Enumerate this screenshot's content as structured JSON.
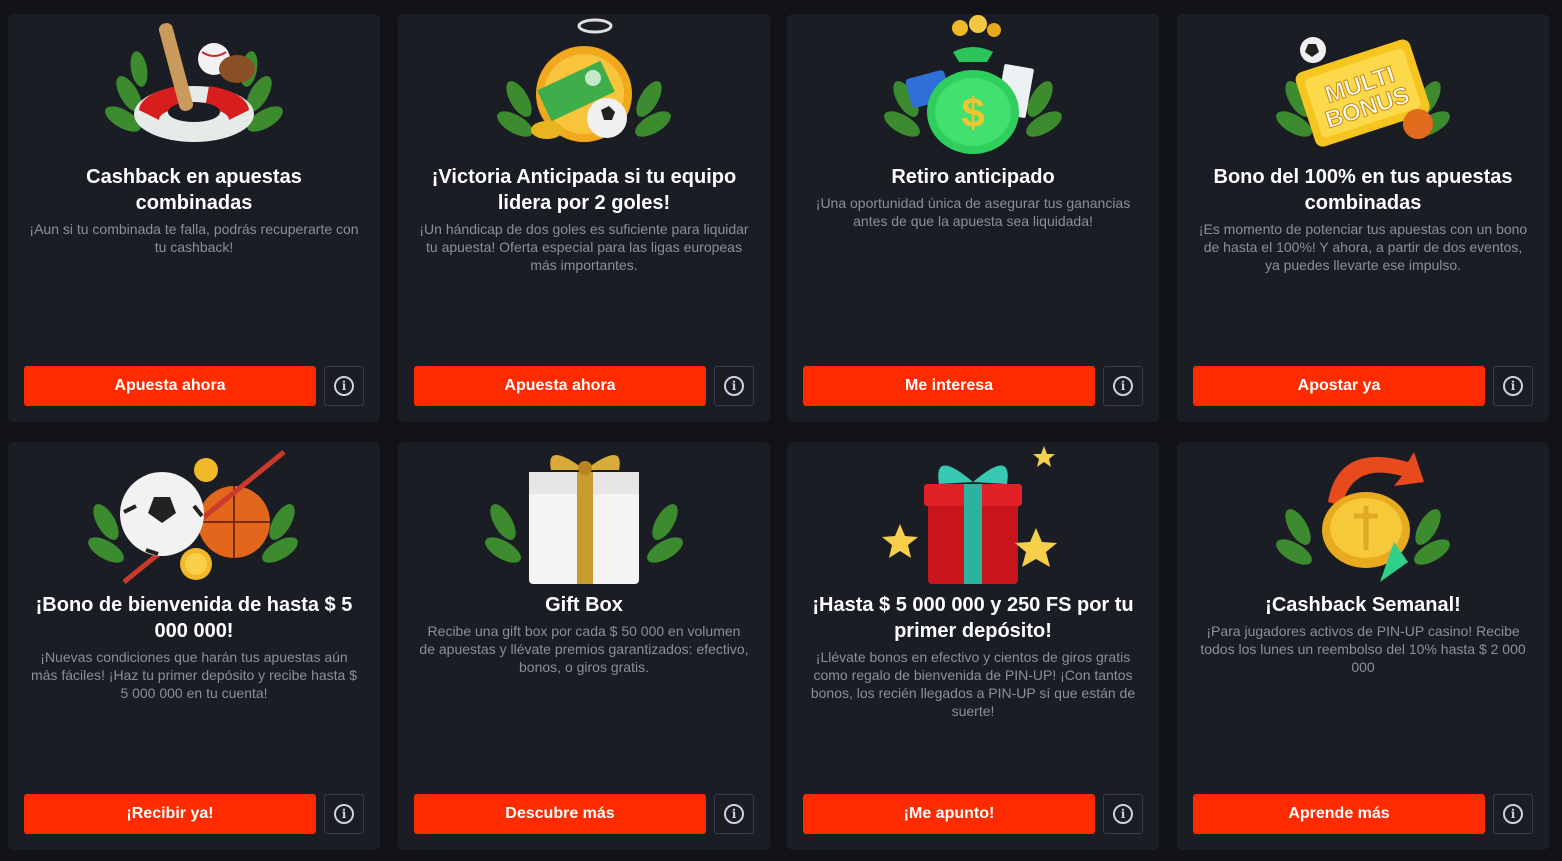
{
  "theme": {
    "page_bg": "#111318",
    "card_bg": "#1b1d25",
    "accent": "#fe2a00",
    "title_color": "#ffffff",
    "desc_color": "#8b8f99"
  },
  "cards": [
    {
      "art_icon": "baseball-lifebuoy-laurel-icon",
      "title": "Cashback en apuestas combinadas",
      "description": "¡Aun si tu combinada te falla, podrás recuperarte con tu cashback!",
      "button_label": "Apuesta ahora"
    },
    {
      "art_icon": "stopwatch-soccer-laurel-icon",
      "title": "¡Victoria Anticipada si tu equipo lidera por 2 goles!",
      "description": "¡Un hándicap de dos goles es suficiente para liquidar tu apuesta! Oferta especial para las ligas europeas más importantes.",
      "button_label": "Apuesta ahora"
    },
    {
      "art_icon": "money-bag-laurel-icon",
      "title": "Retiro anticipado",
      "description": "¡Una oportunidad única de asegurar tus ganancias antes de que la apuesta sea liquidada!",
      "button_label": "Me interesa"
    },
    {
      "art_icon": "multi-bonus-ticket-icon",
      "art_text": "MULTI BONUS",
      "title": "Bono del 100% en tus apuestas combinadas",
      "description": "¡Es momento de potenciar tus apuestas con un bono de hasta el 100%! Y ahora, a partir de dos eventos, ya puedes llevarte ese impulso.",
      "button_label": "Apostar ya"
    },
    {
      "art_icon": "soccer-basketball-coins-icon",
      "title": "¡Bono de bienvenida de hasta $ 5 000 000!",
      "description": "¡Nuevas condiciones que harán tus apuestas aún más fáciles! ¡Haz tu primer depósito y recibe hasta $ 5 000 000 en tu cuenta!",
      "button_label": "¡Recibir ya!"
    },
    {
      "art_icon": "white-gift-box-icon",
      "title": "Gift Box",
      "description": "Recibe una gift box por cada $ 50 000 en volumen de apuestas y llévate premios garantizados: efectivo, bonos, o giros gratis.",
      "button_label": "Descubre más"
    },
    {
      "art_icon": "red-gift-stars-icon",
      "title": "¡Hasta $ 5 000 000 y 250 FS por tu primer depósito!",
      "description": "¡Llévate bonos en efectivo y cientos de giros gratis como regalo de bienvenida de PIN-UP! ¡Con tantos bonos, los recién llegados a PIN-UP sí que están de suerte!",
      "button_label": "¡Me apunto!"
    },
    {
      "art_icon": "cashback-coin-arrows-icon",
      "title": "¡Cashback Semanal!",
      "description": "¡Para jugadores activos de PIN-UP casino! Recibe todos los lunes un reembolso del 10% hasta $ 2 000 000",
      "button_label": "Aprende más"
    }
  ]
}
